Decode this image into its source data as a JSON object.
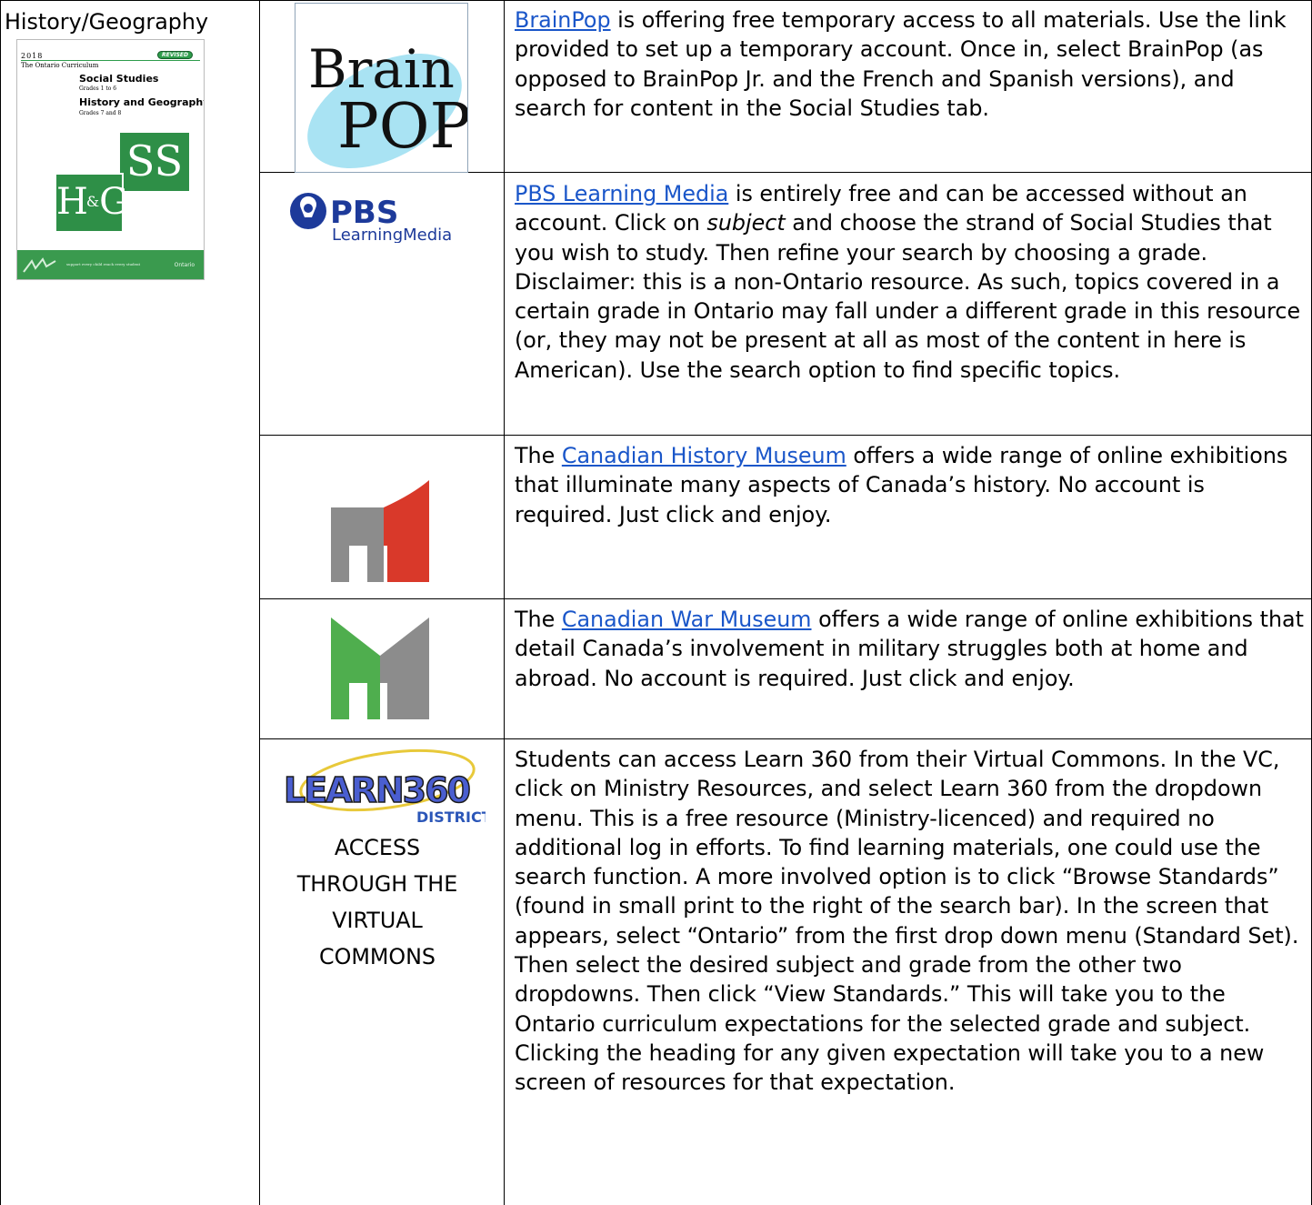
{
  "subject": "History/Geography",
  "cover": {
    "year": "2018",
    "badge": "REVISED",
    "series": "The Ontario Curriculum",
    "title1": "Social Studies",
    "grades1": "Grades 1 to 6",
    "title2": "History and Geography",
    "grades2": "Grades 7 and 8",
    "mark_top": "SS",
    "mark_bottom_h": "H",
    "mark_bottom_amp": "&",
    "mark_bottom_g": "G",
    "footer_left": "support every child reach every student",
    "footer_right": "Ontario"
  },
  "logos": {
    "brainpop_line1": "Brain",
    "brainpop_line2": "POP",
    "pbs_main": "PBS",
    "pbs_sub": "LearningMedia",
    "learn360_main": "LEARN360",
    "learn360_sub": "DISTRICT"
  },
  "access_note": [
    "ACCESS",
    "THROUGH THE",
    "VIRTUAL",
    "COMMONS"
  ],
  "resources": [
    {
      "link": "BrainPop",
      "text": " is offering free temporary access to all materials. Use the link provided to set up a temporary account. Once in, select BrainPop (as opposed to BrainPop Jr. and the French and Spanish versions), and search for content in the Social Studies tab."
    },
    {
      "link": "PBS Learning Media",
      "text_a": " is entirely free and can be accessed without an account. Click on ",
      "emph": "subject",
      "text_b": " and choose the strand of Social Studies that you wish to study. Then refine your search by choosing a grade. Disclaimer: this is a non-Ontario resource. As such, topics covered in a certain grade in Ontario may fall under a different grade in this resource (or, they may not be present at all as most of the content in here is American). Use the search option to find specific topics."
    },
    {
      "prefix": "The ",
      "link": "Canadian History Museum",
      "text": " offers a wide range of online exhibitions that illuminate many aspects of Canada’s history. No account is required. Just click and enjoy."
    },
    {
      "prefix": "The ",
      "link": "Canadian War Museum",
      "text": " offers a wide range of online exhibitions that detail Canada’s involvement in military struggles both at home and abroad. No account is required. Just click and enjoy."
    },
    {
      "text": "Students can access Learn 360 from their Virtual Commons. In the VC, click on Ministry Resources, and select Learn 360 from the dropdown menu. This is a free resource (Ministry-licenced) and required no additional log in efforts. To find learning materials, one could use the search function. A more involved option is to click “Browse Standards” (found in small print to the right of the search bar). In the screen that appears, select “Ontario” from the first drop down menu (Standard Set). Then select the desired subject and grade from the other two dropdowns. Then click “View Standards.” This will take you to the Ontario curriculum expectations for the selected grade and subject. Clicking the heading for any given expectation will take you to a new screen of resources for that expectation."
    }
  ],
  "colors": {
    "link": "#1a56c9",
    "museum_grey": "#8c8c8c",
    "history_red": "#d9392a",
    "war_green": "#4fae4e",
    "pbs_blue": "#1d3a9a",
    "cover_green": "#2e8f47"
  }
}
